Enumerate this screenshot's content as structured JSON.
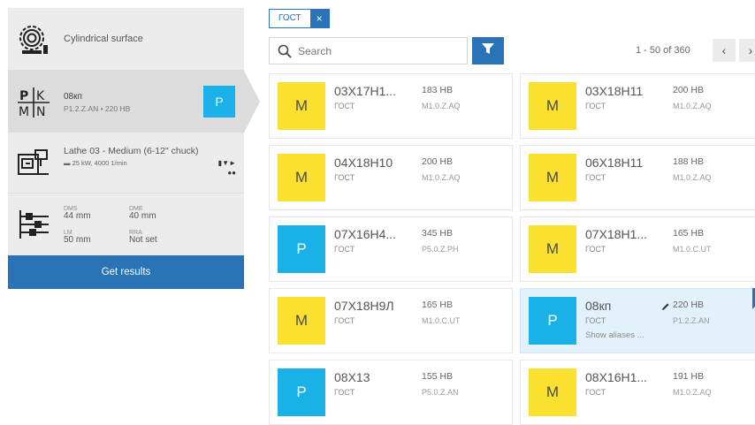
{
  "sidebar": {
    "surface": {
      "label": "Cylindrical surface",
      "icon": "cylindrical-surface-icon"
    },
    "material": {
      "icon": "material-group-icon",
      "icon_letters": [
        "P",
        "K",
        "M",
        "N"
      ],
      "grade": "08кп",
      "sub": "P1.2.Z.AN • 220 HB",
      "badge": "P"
    },
    "machine": {
      "icon": "lathe-icon",
      "name": "Lathe 03 - Medium (6-12\" chuck)",
      "spec": "25 kW, 4000 1/min",
      "tools_icon": "tool-holders-icon"
    },
    "params": {
      "icon": "cutting-params-icon",
      "items": [
        {
          "key": "DMS",
          "value": "44 mm"
        },
        {
          "key": "DME",
          "value": "40 mm"
        },
        {
          "key": "LM",
          "value": "50 mm"
        },
        {
          "key": "RRA",
          "value": "Not set"
        }
      ]
    },
    "get_results": "Get results"
  },
  "filter": {
    "chip": "ГОСТ",
    "chip_close": "×"
  },
  "search": {
    "placeholder": "Search"
  },
  "pagination": {
    "range": "1 - 50 of 360",
    "prev": "‹",
    "next": "›"
  },
  "cards": [
    {
      "group": "M",
      "name": "03X17H1...",
      "standard": "ГОСТ",
      "hardness": "183 HB",
      "code": "M1.0.Z.AQ"
    },
    {
      "group": "M",
      "name": "03X18H11",
      "standard": "ГОСТ",
      "hardness": "200 HB",
      "code": "M1.0.Z.AQ"
    },
    {
      "group": "M",
      "name": "04X18H10",
      "standard": "ГОСТ",
      "hardness": "200 HB",
      "code": "M1.0.Z.AQ"
    },
    {
      "group": "M",
      "name": "06X18H11",
      "standard": "ГОСТ",
      "hardness": "188 HB",
      "code": "M1.0.Z.AQ"
    },
    {
      "group": "P",
      "name": "07X16H4...",
      "standard": "ГОСТ",
      "hardness": "345 HB",
      "code": "P5.0.Z.PH"
    },
    {
      "group": "M",
      "name": "07X18H1...",
      "standard": "ГОСТ",
      "hardness": "165 HB",
      "code": "M1.0.C.UT"
    },
    {
      "group": "M",
      "name": "07X18H9Л",
      "standard": "ГОСТ",
      "hardness": "165 HB",
      "code": "M1.0.C.UT"
    },
    {
      "group": "P",
      "name": "08кп",
      "standard": "ГОСТ",
      "hardness": "220 HB",
      "code": "P1.2.Z.AN",
      "selected": true,
      "aliases": "Show aliases ..."
    },
    {
      "group": "P",
      "name": "08X13",
      "standard": "ГОСТ",
      "hardness": "155 HB",
      "code": "P5.0.Z.AN"
    },
    {
      "group": "M",
      "name": "08X16H1...",
      "standard": "ГОСТ",
      "hardness": "191 HB",
      "code": "M1.0.Z.AQ"
    }
  ],
  "colors": {
    "accent": "#2a73b6",
    "group_M": "#fbe12f",
    "group_P": "#1ab1e6",
    "panel": "#ececec"
  }
}
